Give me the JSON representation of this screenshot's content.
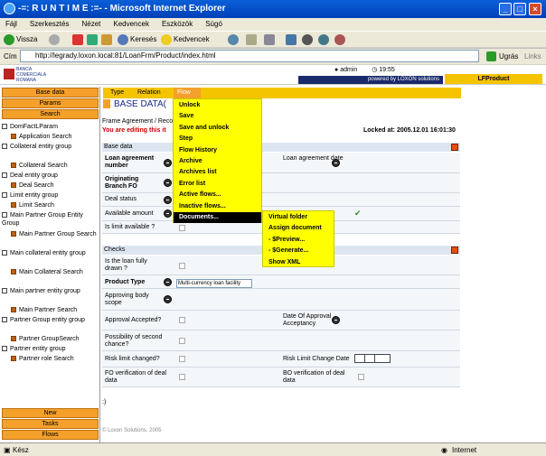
{
  "window": {
    "title": "-=: R U N T I M E :=- - Microsoft Internet Explorer"
  },
  "menubar": [
    "Fájl",
    "Szerkesztés",
    "Nézet",
    "Kedvencek",
    "Eszközök",
    "Súgó"
  ],
  "toolbar": {
    "back": "Vissza",
    "search": "Keresés",
    "favorites": "Kedvencek"
  },
  "address": {
    "label": "Cím",
    "url": "http://legrady.loxon.local:81/LoanFrm/Product/index.html",
    "go": "Ugrás",
    "links": "Links"
  },
  "header": {
    "logo_line1": "BANCA",
    "logo_line2": "COMERCIALA",
    "logo_line3": "ROMANA",
    "user": "admin",
    "time": "19:55",
    "powered": "powered by LOXON solutions",
    "app": "LFProduct"
  },
  "leftnav": {
    "top_buttons": [
      "Base data",
      "Params",
      "Search"
    ],
    "tree": [
      {
        "label": "DomFactLParam",
        "level": 0,
        "folder": false
      },
      {
        "label": "Application Search",
        "level": 1,
        "folder": true
      },
      {
        "label": "Collateral entity group",
        "level": 0,
        "folder": false
      },
      {
        "label": "Collateral Search",
        "level": 1,
        "folder": true
      },
      {
        "label": "Deal entity group",
        "level": 0,
        "folder": false
      },
      {
        "label": "Deal Search",
        "level": 1,
        "folder": true
      },
      {
        "label": "Limit entity group",
        "level": 0,
        "folder": false
      },
      {
        "label": "Limit Search",
        "level": 1,
        "folder": true
      },
      {
        "label": "Main Partner Group Entity Group",
        "level": 0,
        "folder": false
      },
      {
        "label": "Main Partner Group Search",
        "level": 1,
        "folder": true
      },
      {
        "label": "Main collateral entity group",
        "level": 0,
        "folder": false
      },
      {
        "label": "Main Collateral Search",
        "level": 1,
        "folder": true
      },
      {
        "label": "Main partner entity group",
        "level": 0,
        "folder": false
      },
      {
        "label": "Main Partner Search",
        "level": 1,
        "folder": true
      },
      {
        "label": "Partner Group entity group",
        "level": 0,
        "folder": false
      },
      {
        "label": "Partner GroupSearch",
        "level": 1,
        "folder": true
      },
      {
        "label": "Partner entity group",
        "level": 0,
        "folder": false
      },
      {
        "label": "Partner role Search",
        "level": 1,
        "folder": true
      }
    ],
    "bottom_buttons": [
      "New",
      "Tasks",
      "Flows"
    ]
  },
  "tabs": [
    "Type",
    "Relation",
    "Flow"
  ],
  "main": {
    "title": "BASE DATA(",
    "breadcrumb": "Frame Agreement / Reco",
    "warning": "You are editing this it",
    "locked": "Locked at: 2005.12.01 16:01:30",
    "section_base": "Base data",
    "section_checks": "Checks",
    "footer_text": ":)",
    "copyright": "© Loxon Solutions, 2005"
  },
  "base_fields": {
    "loan_no": "Loan agreement number",
    "branch": "Originating Branch FO",
    "deal_status": "Deal status",
    "avail_amount": "Available amount",
    "limit_avail": "Is limit available ?",
    "loan_date": "Loan agreement date"
  },
  "check_fields": {
    "fully_drawn": "Is the loan fully drawn ?",
    "product_type": "Product Type",
    "product_type_value": "Multi-currency loan facility",
    "approving_body": "Approving body scope",
    "approval_accepted": "Approval Accepted?",
    "approval_date": "Date Of Approval Acceptancy",
    "second_chance": "Possibility of second chance?",
    "risk_changed": "Risk limit changed?",
    "risk_change_date": "Risk Limit Change Date",
    "fo_verification": "FO verification of deal data",
    "bo_verification": "BO verification of deal data"
  },
  "flow_menu": [
    "Unlock",
    "Save",
    "Save and unlock",
    "Step",
    "Flow History",
    "Archive",
    "Archives list",
    "Error list",
    "Active flows...",
    "Inactive flows...",
    "Documents..."
  ],
  "docs_menu": [
    "Virtual folder",
    "Assign document",
    "- $Preview...",
    "- $Generate...",
    "Show XML"
  ],
  "status": {
    "left": "Kész",
    "zone": "Internet"
  },
  "colors": {
    "accent": "#f5a02a",
    "menu": "#ffff00",
    "tabbar": "#f5c400"
  }
}
